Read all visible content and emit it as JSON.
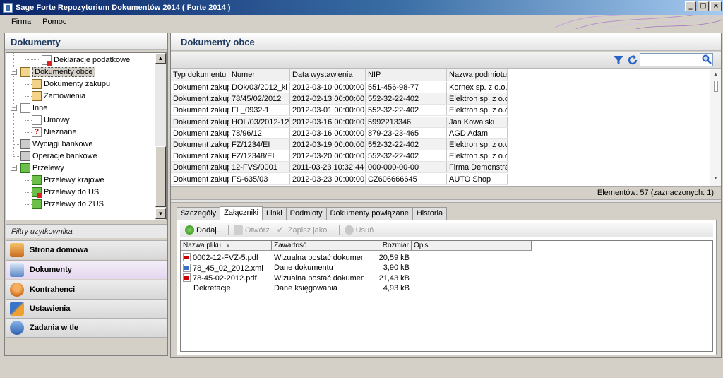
{
  "window": {
    "title": "Sage Forte Repozytorium Dokumentów 2014 ( Forte 2014 )",
    "buttons": {
      "minimize": "_",
      "maximize": "□",
      "close": "×"
    }
  },
  "menu": [
    "Firma",
    "Pomoc"
  ],
  "left_panel": {
    "title": "Dokumenty",
    "tree": [
      {
        "label": "Deklaracje podatkowe"
      },
      {
        "label": "Dokumenty obce",
        "selected": true
      },
      {
        "label": "Dokumenty zakupu"
      },
      {
        "label": "Zamówienia"
      },
      {
        "label": "Inne"
      },
      {
        "label": "Umowy"
      },
      {
        "label": "Nieznane"
      },
      {
        "label": "Wyciągi bankowe"
      },
      {
        "label": "Operacje bankowe"
      },
      {
        "label": "Przelewy"
      },
      {
        "label": "Przelewy krajowe"
      },
      {
        "label": "Przelewy do US"
      },
      {
        "label": "Przelewy do ZUS"
      }
    ],
    "filters_label": "Filtry użytkownika",
    "nav": [
      "Strona domowa",
      "Dokumenty",
      "Kontrahenci",
      "Ustawienia",
      "Zadania w tle"
    ]
  },
  "right_panel": {
    "title": "Dokumenty obce",
    "search": {
      "value": ""
    },
    "columns": [
      "Typ dokumentu",
      "Numer",
      "Data wystawienia",
      "NIP",
      "Nazwa podmiotu"
    ],
    "rows": [
      [
        "Dokument zakupu",
        "DOk/03/2012_kl",
        "2012-03-10 00:00:00",
        "551-456-98-77",
        "Kornex sp. z o.o."
      ],
      [
        "Dokument zakupu",
        "78/45/02/2012",
        "2012-02-13 00:00:00",
        "552-32-22-402",
        "Elektron sp. z o.o."
      ],
      [
        "Dokument zakupu",
        "FL_0932-1",
        "2012-03-01 00:00:00",
        "552-32-22-402",
        "Elektron sp. z o.o."
      ],
      [
        "Dokument zakupu",
        "HOL/03/2012-12",
        "2012-03-16 00:00:00",
        "5992213346",
        "Jan Kowalski"
      ],
      [
        "Dokument zakupu",
        "78/96/12",
        "2012-03-16 00:00:00",
        "879-23-23-465",
        "AGD Adam"
      ],
      [
        "Dokument zakupu",
        "FZ/1234/EI",
        "2012-03-19 00:00:00",
        "552-32-22-402",
        "Elektron sp. z o.o."
      ],
      [
        "Dokument zakupu",
        "FZ/12348/EI",
        "2012-03-20 00:00:00",
        "552-32-22-402",
        "Elektron sp. z o.o."
      ],
      [
        "Dokument zakupu",
        "12-FVS/0001",
        "2011-03-23 10:32:44",
        "000-000-00-00",
        "Firma Demonstra…"
      ],
      [
        "Dokument zakupu",
        "FS-635/03",
        "2012-03-23 00:00:00",
        "CZ606666645",
        "AUTO Shop"
      ]
    ],
    "footer": "Elementów: 57 (zaznaczonych: 1)",
    "tabs": [
      "Szczegóły",
      "Załączniki",
      "Linki",
      "Podmioty",
      "Dokumenty powiązane",
      "Historia"
    ],
    "active_tab": "Załączniki",
    "attachment_toolbar": {
      "add": "Dodaj...",
      "open": "Otwórz",
      "save": "Zapisz jako...",
      "delete": "Usuń"
    },
    "attachment_columns": [
      "Nazwa pliku",
      "Zawartość",
      "Rozmiar",
      "Opis"
    ],
    "attachments": [
      {
        "name": "0002-12-FVZ-5.pdf",
        "content": "Wizualna postać dokumentu",
        "size": "20,59 kB",
        "icon": "pdf-icon"
      },
      {
        "name": "78_45_02_2012.xml",
        "content": "Dane dokumentu",
        "size": "3,90 kB",
        "icon": "xml-icon"
      },
      {
        "name": "78-45-02-2012.pdf",
        "content": "Wizualna postać dokumentu",
        "size": "21,43 kB",
        "icon": "pdf-icon"
      },
      {
        "name": "Dekretacje",
        "content": "Dane księgowania",
        "size": "4,93 kB",
        "icon": ""
      }
    ]
  }
}
